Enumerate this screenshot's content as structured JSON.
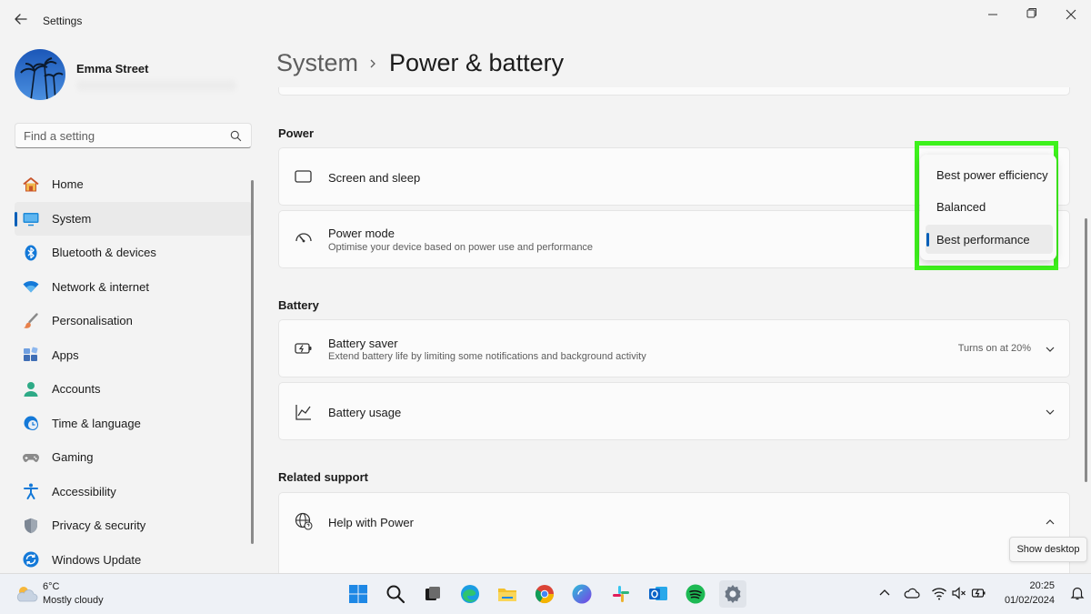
{
  "window": {
    "app_title": "Settings"
  },
  "user": {
    "name": "Emma Street"
  },
  "search": {
    "placeholder": "Find a setting"
  },
  "sidebar": {
    "items": [
      {
        "label": "Home"
      },
      {
        "label": "System"
      },
      {
        "label": "Bluetooth & devices"
      },
      {
        "label": "Network & internet"
      },
      {
        "label": "Personalisation"
      },
      {
        "label": "Apps"
      },
      {
        "label": "Accounts"
      },
      {
        "label": "Time & language"
      },
      {
        "label": "Gaming"
      },
      {
        "label": "Accessibility"
      },
      {
        "label": "Privacy & security"
      },
      {
        "label": "Windows Update"
      }
    ],
    "selected": "System"
  },
  "breadcrumb": {
    "parent": "System",
    "current": "Power & battery"
  },
  "sections": {
    "power": {
      "heading": "Power",
      "screen_sleep": {
        "title": "Screen and sleep"
      },
      "power_mode": {
        "title": "Power mode",
        "desc": "Optimise your device based on power use and performance"
      }
    },
    "battery": {
      "heading": "Battery",
      "saver": {
        "title": "Battery saver",
        "desc": "Extend battery life by limiting some notifications and background activity",
        "status": "Turns on at 20%"
      },
      "usage": {
        "title": "Battery usage"
      }
    },
    "related": {
      "heading": "Related support",
      "help": {
        "title": "Help with Power"
      }
    }
  },
  "power_mode_dropdown": {
    "options": [
      "Best power efficiency",
      "Balanced",
      "Best performance"
    ],
    "selected": "Best performance"
  },
  "tooltip": {
    "text": "Show desktop"
  },
  "taskbar": {
    "weather": {
      "temp": "6°C",
      "desc": "Mostly cloudy"
    },
    "clock": {
      "time": "20:25",
      "date": "01/02/2024"
    }
  },
  "colors": {
    "accent": "#005fb8",
    "highlight": "#3df11c",
    "background": "#f3f3f3",
    "card": "#fbfbfb"
  }
}
